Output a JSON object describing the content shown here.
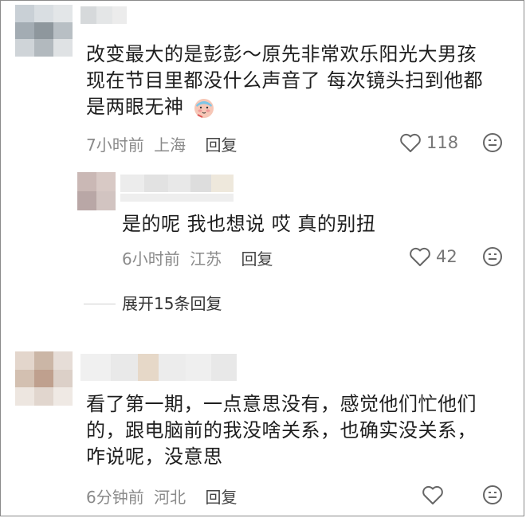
{
  "comments": [
    {
      "text_lines": [
        "改变最大的是彭彭～原先非常欢乐阳光大男孩",
        "现在节目里都没什么声音了 每次镜头扫到他都",
        "是两眼无神"
      ],
      "emoji": "face-with-bandage-emoji",
      "time": "7小时前",
      "location": "上海",
      "reply_label": "回复",
      "likes": "118"
    },
    {
      "text_lines": [
        "是的呢 我也想说 哎 真的别扭"
      ],
      "time": "6小时前",
      "location": "江苏",
      "reply_label": "回复",
      "likes": "42"
    },
    {
      "text_lines": [
        "看了第一期，一点意思没有，感觉他们忙他们",
        "的，跟电脑前的我没啥关系，也确实没关系，",
        "咋说呢，没意思"
      ],
      "time": "6分钟前",
      "location": "河北",
      "reply_label": "回复",
      "likes": ""
    }
  ],
  "expand_replies": "展开15条回复",
  "icons": {
    "like": "heart-icon",
    "more": "emoji-reaction-icon"
  },
  "colors": {
    "meta": "#8a8a8a",
    "text": "#1e1e1e",
    "border": "#8a8a8a"
  }
}
